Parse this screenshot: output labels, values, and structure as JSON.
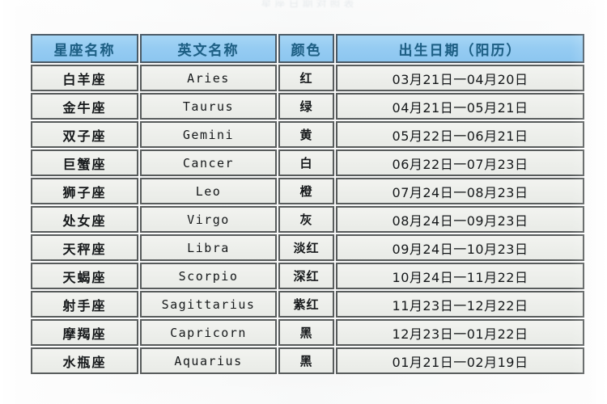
{
  "title_remnant": "星座日期对照表",
  "table": {
    "columns": [
      {
        "key": "cn_name",
        "label": "星座名称"
      },
      {
        "key": "en_name",
        "label": "英文名称"
      },
      {
        "key": "color",
        "label": "颜色"
      },
      {
        "key": "date",
        "label": "出生日期（阳历）"
      }
    ],
    "rows": [
      {
        "cn_name": "白羊座",
        "en_name": "Aries",
        "color": "红",
        "date": "03月21日一04月20日"
      },
      {
        "cn_name": "金牛座",
        "en_name": "Taurus",
        "color": "绿",
        "date": "04月21日一05月21日"
      },
      {
        "cn_name": "双子座",
        "en_name": "Gemini",
        "color": "黄",
        "date": "05月22日一06月21日"
      },
      {
        "cn_name": "巨蟹座",
        "en_name": "Cancer",
        "color": "白",
        "date": "06月22日一07月23日"
      },
      {
        "cn_name": "狮子座",
        "en_name": "Leo",
        "color": "橙",
        "date": "07月24日一08月23日"
      },
      {
        "cn_name": "处女座",
        "en_name": "Virgo",
        "color": "灰",
        "date": "08月24日一09月23日"
      },
      {
        "cn_name": "天秤座",
        "en_name": "Libra",
        "color": "淡红",
        "date": "09月24日一10月23日"
      },
      {
        "cn_name": "天蝎座",
        "en_name": "Scorpio",
        "color": "深红",
        "date": "10月24日一11月22日"
      },
      {
        "cn_name": "射手座",
        "en_name": "Sagittarius",
        "color": "紫红",
        "date": "11月23日一12月22日"
      },
      {
        "cn_name": "摩羯座",
        "en_name": "Capricorn",
        "color": "黑",
        "date": "12月23日一01月22日"
      },
      {
        "cn_name": "水瓶座",
        "en_name": "Aquarius",
        "color": "黑",
        "date": "01月21日一02月19日"
      }
    ]
  },
  "colors": {
    "header_bg": "#8cc6f0",
    "header_text": "#1d5f84",
    "cell_bg": "#eceeea",
    "border": "#575b5b",
    "page_bg": "#f7f8f8"
  }
}
